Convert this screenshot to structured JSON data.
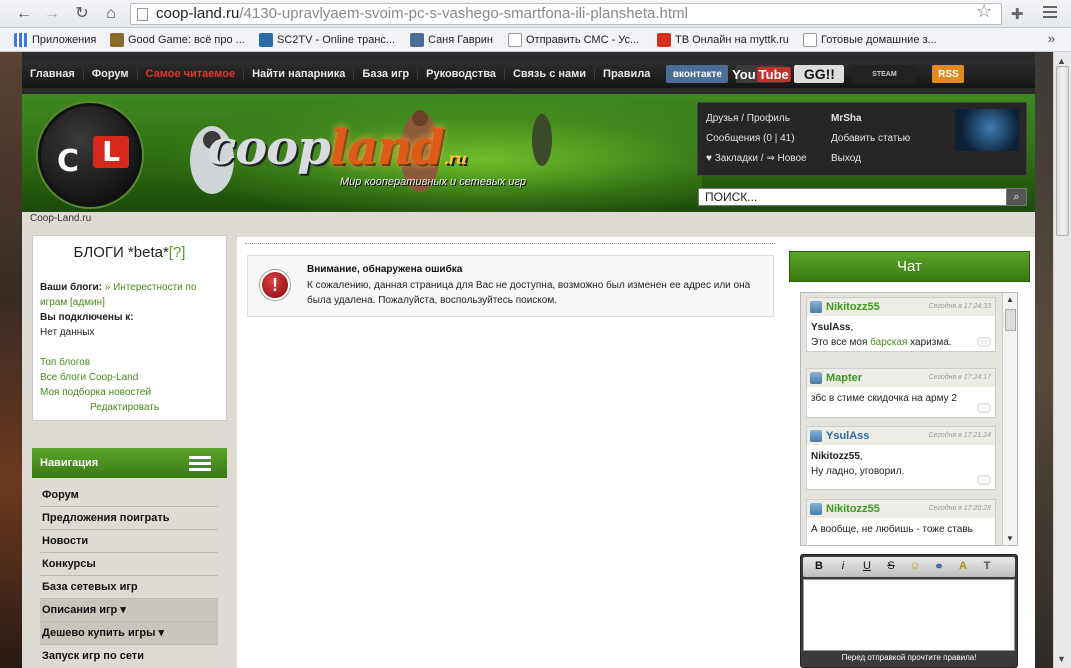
{
  "browser": {
    "url_domain": "coop-land.ru",
    "url_path": "/4130-upravlyaem-svoim-pc-s-vashego-smartfona-ili-plansheta.html",
    "bookmarks": [
      {
        "label": "Приложения",
        "icon": "apps-grid-icon",
        "color": "#3c78d8"
      },
      {
        "label": "Good Game: всё про ...",
        "icon": "goodgame-icon",
        "color": "#8a6a2a"
      },
      {
        "label": "SC2TV - Online транс...",
        "icon": "sc2tv-icon",
        "color": "#2a6aa8"
      },
      {
        "label": "Саня Гаврин",
        "icon": "vk-icon",
        "color": "#4a6e96"
      },
      {
        "label": "Отправить СМС - Ус...",
        "icon": "page-icon",
        "color": "#ffffff"
      },
      {
        "label": "ТВ Онлайн на myttk.ru",
        "icon": "ttk-icon",
        "color": "#d83020"
      },
      {
        "label": "Готовые домашние з...",
        "icon": "page-icon",
        "color": "#ffffff"
      }
    ],
    "more": "»"
  },
  "site": {
    "topnav": [
      {
        "label": "Главная",
        "red": false
      },
      {
        "label": "Форум",
        "red": false
      },
      {
        "label": "Самое читаемое",
        "red": true
      },
      {
        "label": "Найти напарника",
        "red": false
      },
      {
        "label": "База игр",
        "red": false
      },
      {
        "label": "Руководства",
        "red": false
      },
      {
        "label": "Связь с нами",
        "red": false
      },
      {
        "label": "Правила",
        "red": false
      }
    ],
    "social": {
      "vk": "вконтакте",
      "youtube_you": "You",
      "youtube_tube": "Tube",
      "gg": "GG!!",
      "steam": "STEAM",
      "rss": "RSS"
    },
    "logo": {
      "cl_c": "C",
      "cl_l": "L",
      "main": "coop",
      "land": "land",
      "ru": ".ru",
      "slogan": "Мир кооперативных и сетевых игр"
    },
    "user_panel": {
      "friends": "Друзья / Профиль",
      "username": "MrSha",
      "messages": "Сообщения (0 | 41)",
      "add_article": "Добавить статью",
      "bookmarks": "♥ Закладки / ⇒ Новое",
      "logout": "Выход"
    },
    "search_placeholder": "ПОИСК...",
    "breadcrumb": "Coop-Land.ru"
  },
  "blogs": {
    "title": "БЛОГИ *beta*",
    "help": "[?]",
    "your_blogs_label": "Ваши блоги:",
    "your_blogs_link_1": "» Интерестности по",
    "your_blogs_link_2": "играм [админ]",
    "subscribed_label": "Вы подключены к:",
    "no_data": "Нет данных",
    "links": [
      "Топ блогов",
      "Все блоги Coop-Land",
      "Моя подборка новостей"
    ],
    "edit": "Редактировать"
  },
  "navigation": {
    "title": "Навигация",
    "items": [
      {
        "label": "Форум",
        "selected": false
      },
      {
        "label": "Предложения поиграть",
        "selected": false
      },
      {
        "label": "Новости",
        "selected": false
      },
      {
        "label": "Конкурсы",
        "selected": false
      },
      {
        "label": "База сетевых игр",
        "selected": false
      },
      {
        "label": "Описания игр ▾",
        "selected": true
      },
      {
        "label": "Дешево купить игры ▾",
        "selected": true
      },
      {
        "label": "Запуск игр по сети",
        "selected": false
      }
    ]
  },
  "error": {
    "icon": "!",
    "title": "Внимание, обнаружена ошибка",
    "text": "К сожалению, данная страница для Вас не доступна, возможно был изменен ее адрес или она была удалена. Пожалуйста, воспользуйтесь поиском."
  },
  "chat": {
    "title": "Чат",
    "messages": [
      {
        "name": "Nikitozz55",
        "time": "Сегодня в 17:24:33",
        "line1_bold": "YsulAss",
        "line1": ",",
        "line2_pre": "Это все моя ",
        "line2_link": "барская",
        "line2_post": " харизма.",
        "name_color": "green"
      },
      {
        "name": "Mapter",
        "time": "Сегодня в 17:24:17",
        "line1_bold": "",
        "line1": "збс в стиме скидочка на арму 2",
        "line2_pre": "",
        "line2_link": "",
        "line2_post": "",
        "name_color": "green"
      },
      {
        "name": "YsulAss",
        "time": "Сегодня в 17:21:24",
        "line1_bold": "Nikitozz55",
        "line1": ",",
        "line2_pre": "Ну ладно, уговорил.",
        "line2_link": "",
        "line2_post": "",
        "name_color": "blue"
      },
      {
        "name": "Nikitozz55",
        "time": "Сегодня в 17:20:28",
        "line1_bold": "",
        "line1": "А вообще, не любишь - тоже ставь",
        "line2_pre": "",
        "line2_link": "",
        "line2_post": "",
        "name_color": "green"
      }
    ],
    "toolbar": [
      "B",
      "i",
      "U",
      "S",
      "☺",
      "⚭",
      "A",
      "T"
    ],
    "rules_note": "Перед отправкой прочтите правила!"
  }
}
